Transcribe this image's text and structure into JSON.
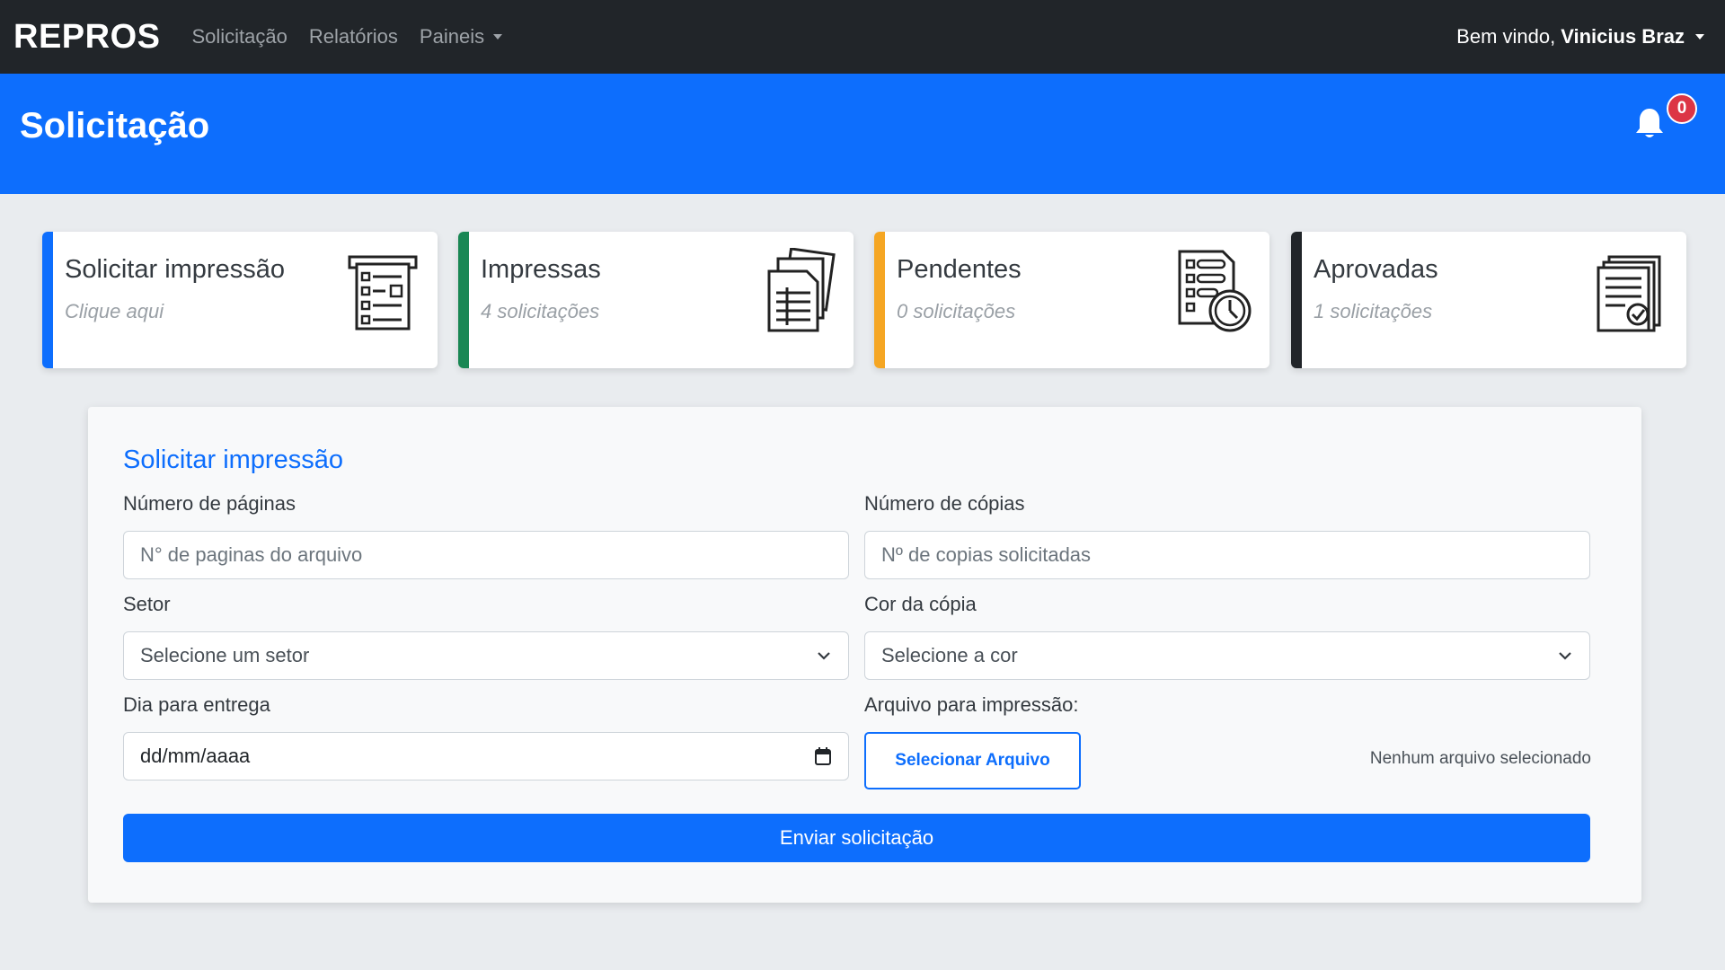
{
  "navbar": {
    "brand": "REPROS",
    "links": [
      "Solicitação",
      "Relatórios",
      "Paineis"
    ],
    "welcome": "Bem vindo,",
    "user_name": "Vinicius Braz"
  },
  "header": {
    "title": "Solicitação",
    "notification_count": "0"
  },
  "cards": [
    {
      "title": "Solicitar impressão",
      "subtitle": "Clique aqui",
      "accent": "#0d6efd",
      "icon": "form-list-icon"
    },
    {
      "title": "Impressas",
      "subtitle": "4 solicitações",
      "accent": "#198754",
      "icon": "documents-icon"
    },
    {
      "title": "Pendentes",
      "subtitle": "0 solicitações",
      "accent": "#f5a623",
      "icon": "checklist-clock-icon"
    },
    {
      "title": "Aprovadas",
      "subtitle": "1 solicitações",
      "accent": "#212529",
      "icon": "document-approved-icon"
    }
  ],
  "form": {
    "title": "Solicitar impressão",
    "pages_label": "Número de páginas",
    "pages_placeholder": "N° de paginas do arquivo",
    "copies_label": "Número de cópias",
    "copies_placeholder": "Nº de copias solicitadas",
    "sector_label": "Setor",
    "sector_value": "Selecione um setor",
    "color_label": "Cor da cópia",
    "color_value": "Selecione a cor",
    "date_label": "Dia para entrega",
    "date_value": "dd/mm/aaaa",
    "file_label": "Arquivo para impressão:",
    "file_button": "Selecionar Arquivo",
    "file_status": "Nenhum arquivo selecionado",
    "submit": "Enviar solicitação"
  }
}
